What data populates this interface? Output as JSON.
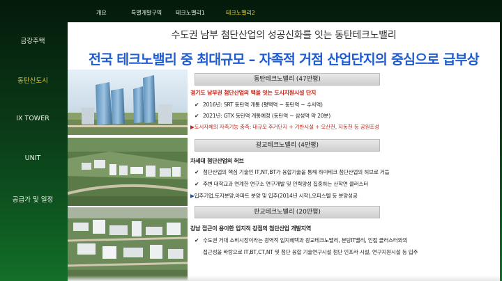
{
  "topnav": {
    "items": [
      "개요",
      "특별개발구역",
      "테크노밸리1",
      "테크노밸리2"
    ],
    "active_index": 3
  },
  "sidenav": {
    "items": [
      "금강주택",
      "동탄신도시",
      "IX TOWER",
      "UNIT",
      "공급가 및 일정"
    ],
    "active_index": 1
  },
  "main": {
    "subtitle": "수도권 남부 첨단산업의 성공신화를 잇는 동탄테크노밸리",
    "headline": "전국 테크노밸리 중 최대규모 – 자족적 거점 산업단지의 중심으로 급부상",
    "sections": [
      {
        "header": "동탄테크노밸리 (47만평)",
        "lead": "경기도 남부권 첨단산업의 맥을 잇는 도시지원시설 단지",
        "bullets": [
          "2016년: SRT 동탄역 개통 (평택역 ~ 동탄역 ~ 수서역)",
          "2021년: GTX 동탄역 개통예정 (동탄역 ~ 삼성역 약 20분)"
        ],
        "extra": "도시자체의 자족기능 충족: 대규모 주거단지 + 기반시설 + 오산천, 지동천 등 공원조성"
      },
      {
        "header": "광교테크노밸리 (4만평)",
        "lead": "차세대 첨단산업의 허브",
        "bullets": [
          "첨단산업의 핵심 기술인 IT,NT,BT가 융합기술을 통해 하이테크 첨단산업의 허브로 거듭",
          "주변 대학교과 연계한 연구소 연구개발 및 인력양성 집중하는 산학연 클러스터"
        ],
        "extra": "입주기업,토지분양,아파트 분양 및 입주(2014년 시작),오피스텔 등 분양성공"
      },
      {
        "header": "판교테크노밸리 (20만평)",
        "lead": "강남 접근이 용이한 입지적 강점의 첨단산업 개발지역",
        "bullets": [
          "수도권 거대 소비시장이라는 광역적 입지혜택과 광교테크노밸리, 분당IT벨리, 인접 클러스터와의"
        ],
        "continuation": "접근성을 바탕으로 IT,BT,CT,NT 및 첨단 융합 기술연구시설 첨단 인프라 시설, 연구지원시설 등 입주"
      }
    ],
    "icons": {
      "check": "check-icon",
      "triangle": "triangle-bullet-icon"
    },
    "colors": {
      "headline": "#1e5cd0",
      "active_nav": "#f2d23a",
      "lead_red": "#c0281d"
    }
  }
}
